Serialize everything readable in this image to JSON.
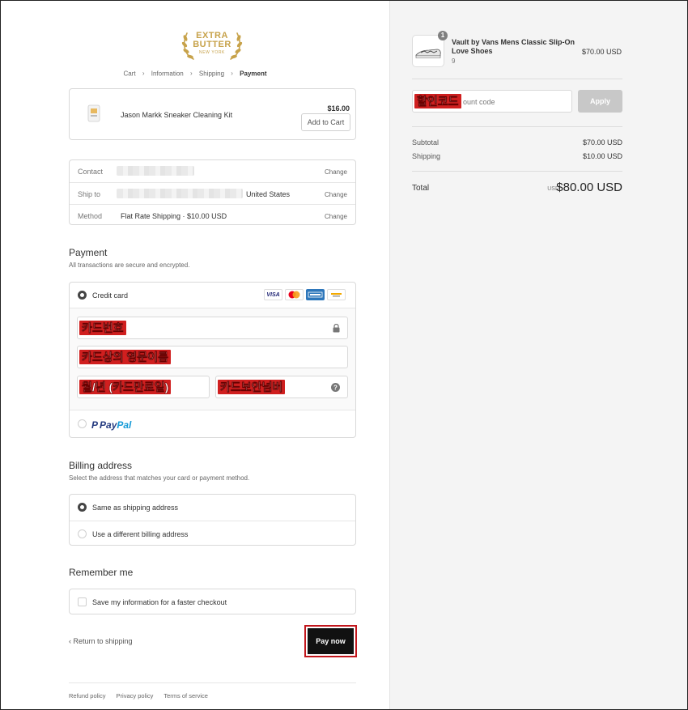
{
  "logo": {
    "line1": "EXTRA",
    "line2": "BUTTER",
    "line3": "NEW YORK"
  },
  "breadcrumb": [
    "Cart",
    "Information",
    "Shipping",
    "Payment"
  ],
  "upsell": {
    "name": "Jason Markk Sneaker Cleaning Kit",
    "price": "$16.00",
    "button": "Add to Cart"
  },
  "review": {
    "contact_label": "Contact",
    "ship_label": "Ship to",
    "ship_value": "United States",
    "method_label": "Method",
    "method_value": "Flat Rate Shipping · $10.00 USD",
    "change": "Change"
  },
  "payment": {
    "title": "Payment",
    "subtitle": "All transactions are secure and encrypted.",
    "credit_card_label": "Credit card",
    "card_number": "카드번호",
    "name_on_card": "카드상의 영문이름",
    "expiry": "월/년 (카드만료일)",
    "cvv": "카드보안넘버",
    "paypal_a": "Pay",
    "paypal_b": "Pal",
    "visa": "VISA"
  },
  "billing": {
    "title": "Billing address",
    "subtitle": "Select the address that matches your card or payment method.",
    "same": "Same as shipping address",
    "different": "Use a different billing address"
  },
  "remember": {
    "title": "Remember me",
    "label": "Save my information for a faster checkout"
  },
  "nav": {
    "return": "Return to shipping",
    "pay": "Pay now"
  },
  "footer": [
    "Refund policy",
    "Privacy policy",
    "Terms of service"
  ],
  "order": {
    "quantity": "1",
    "product_name": "Vault by Vans Mens Classic Slip-On Love Shoes",
    "variant": "9",
    "product_price": "$70.00 USD",
    "discount_annotation": "할인코드",
    "discount_placeholder": "ount code",
    "apply": "Apply",
    "subtotal_label": "Subtotal",
    "subtotal": "$70.00 USD",
    "shipping_label": "Shipping",
    "shipping": "$10.00 USD",
    "total_label": "Total",
    "currency": "USD",
    "total": "$80.00 USD"
  },
  "colors": {
    "accent": "#c7a24a",
    "button": "#111111",
    "highlight": "#d01f1f"
  }
}
